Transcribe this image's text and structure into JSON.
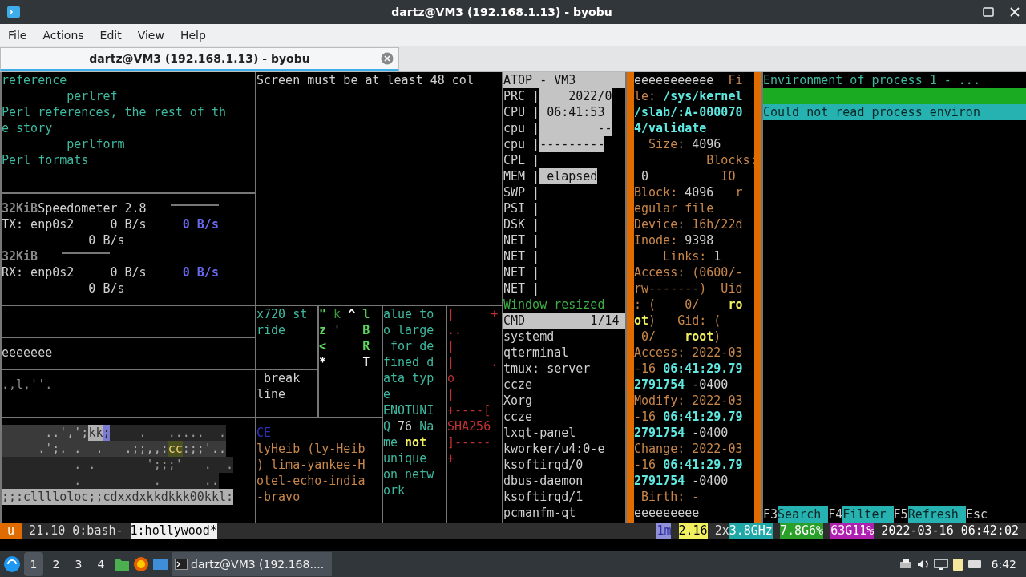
{
  "window": {
    "title": "dartz@VM3 (192.168.1.13) - byobu"
  },
  "menu": [
    "File",
    "Actions",
    "Edit",
    "View",
    "Help"
  ],
  "tabs": [
    {
      "label": "dartz@VM3 (192.168.1.13) - byobu",
      "selected": true
    }
  ],
  "panes": [
    {
      "lines": [
        {
          "segs": [
            {
              "text": "reference",
              "kind": "teal"
            }
          ]
        },
        {
          "segs": [
            {
              "text": "         perlref",
              "kind": "teal"
            }
          ]
        },
        {
          "segs": [
            {
              "text": "Perl references, the rest of th",
              "kind": "teal"
            }
          ]
        },
        {
          "segs": [
            {
              "text": "e story",
              "kind": "teal"
            }
          ]
        },
        {
          "segs": [
            {
              "text": "         perlform",
              "kind": "teal"
            }
          ]
        },
        {
          "segs": [
            {
              "text": "Perl formats",
              "kind": "teal"
            }
          ]
        }
      ]
    },
    {
      "lines": [
        {
          "segs": [
            {
              "text": "Screen must be at least 48 col",
              "kind": "plain"
            }
          ]
        }
      ]
    },
    {
      "lines": [
        {
          "kind": "header",
          "segs": [
            {
              "text": "ATOP - VM3",
              "kind": "inverse"
            }
          ]
        },
        {
          "segs": [
            {
              "text": "PRC |",
              "kind": "plain"
            },
            {
              "text": "    2022/0",
              "kind": "inverse"
            }
          ]
        },
        {
          "segs": [
            {
              "text": "CPU |",
              "kind": "plain"
            },
            {
              "text": " 06:41:53 ",
              "kind": "inverse"
            }
          ]
        },
        {
          "segs": [
            {
              "text": "cpu |",
              "kind": "plain"
            },
            {
              "text": "        --",
              "kind": "inverse"
            }
          ]
        },
        {
          "segs": [
            {
              "text": "cpu |",
              "kind": "plain"
            },
            {
              "text": "---------",
              "kind": "inverse"
            }
          ]
        },
        {
          "segs": [
            {
              "text": "CPL |",
              "kind": "plain"
            }
          ]
        },
        {
          "segs": [
            {
              "text": "MEM |",
              "kind": "plain"
            },
            {
              "text": " elapsed",
              "kind": "inverse"
            }
          ]
        },
        {
          "segs": [
            {
              "text": "SWP |",
              "kind": "plain"
            }
          ]
        },
        {
          "segs": [
            {
              "text": "PSI |",
              "kind": "plain"
            }
          ]
        },
        {
          "segs": [
            {
              "text": "DSK |",
              "kind": "plain"
            }
          ]
        },
        {
          "segs": [
            {
              "text": "NET |",
              "kind": "plain"
            }
          ]
        },
        {
          "segs": [
            {
              "text": "NET |",
              "kind": "plain"
            }
          ]
        },
        {
          "segs": [
            {
              "text": "NET |",
              "kind": "plain"
            }
          ]
        },
        {
          "segs": [
            {
              "text": "NET |",
              "kind": "plain"
            }
          ]
        },
        {
          "segs": [
            {
              "text": "Window resized",
              "kind": "green"
            }
          ]
        },
        {
          "kind": "header",
          "segs": [
            {
              "text": "CMD         1/14",
              "kind": "inverse"
            }
          ]
        },
        {
          "segs": [
            {
              "text": "systemd",
              "kind": "plain"
            }
          ]
        },
        {
          "segs": [
            {
              "text": "qterminal",
              "kind": "plain"
            }
          ]
        },
        {
          "segs": [
            {
              "text": "tmux: server",
              "kind": "plain"
            }
          ]
        },
        {
          "segs": [
            {
              "text": "ccze",
              "kind": "plain"
            }
          ]
        },
        {
          "segs": [
            {
              "text": "Xorg",
              "kind": "plain"
            }
          ]
        },
        {
          "segs": [
            {
              "text": "ccze",
              "kind": "plain"
            }
          ]
        },
        {
          "segs": [
            {
              "text": "lxqt-panel",
              "kind": "plain"
            }
          ]
        },
        {
          "segs": [
            {
              "text": "kworker/u4:0-e",
              "kind": "plain"
            }
          ]
        },
        {
          "segs": [
            {
              "text": "ksoftirqd/0",
              "kind": "plain"
            }
          ]
        },
        {
          "segs": [
            {
              "text": "dbus-daemon",
              "kind": "plain"
            }
          ]
        },
        {
          "segs": [
            {
              "text": "ksoftirqd/1",
              "kind": "plain"
            }
          ]
        },
        {
          "segs": [
            {
              "text": "pcmanfm-qt",
              "kind": "plain"
            }
          ]
        }
      ]
    },
    {
      "lines": [
        {
          "segs": [
            {
              "text": "eeeeeeeeeee  ",
              "kind": "plain"
            },
            {
              "text": "Fi",
              "kind": "orange"
            }
          ]
        },
        {
          "segs": [
            {
              "text": "le: ",
              "kind": "orange"
            },
            {
              "text": "/sys/kernel",
              "kind": "path"
            }
          ]
        },
        {
          "segs": [
            {
              "text": "/slab/:A-000070",
              "kind": "path"
            }
          ]
        },
        {
          "segs": [
            {
              "text": "4/validate",
              "kind": "path"
            }
          ]
        },
        {
          "segs": [
            {
              "text": "  Size: ",
              "kind": "orange"
            },
            {
              "text": "4096",
              "kind": "plain"
            }
          ]
        },
        {
          "segs": [
            {
              "text": "          Blocks:",
              "kind": "orange"
            }
          ]
        },
        {
          "segs": [
            {
              "text": " 0",
              "kind": "plain"
            },
            {
              "text": "          IO",
              "kind": "orange"
            }
          ]
        },
        {
          "segs": [
            {
              "text": "Block: ",
              "kind": "orange"
            },
            {
              "text": "4096",
              "kind": "plain"
            },
            {
              "text": "   r",
              "kind": "orange"
            }
          ]
        },
        {
          "segs": [
            {
              "text": "egular file",
              "kind": "orange"
            }
          ]
        },
        {
          "segs": [
            {
              "text": "Device: 16h/22d",
              "kind": "orange"
            }
          ]
        },
        {
          "segs": [
            {
              "text": "Inode: ",
              "kind": "orange"
            },
            {
              "text": "9398",
              "kind": "plain"
            }
          ]
        },
        {
          "segs": [
            {
              "text": "    Links: ",
              "kind": "orange"
            },
            {
              "text": "1",
              "kind": "plain"
            }
          ]
        },
        {
          "segs": [
            {
              "text": "Access: (0600/-",
              "kind": "orange"
            }
          ]
        },
        {
          "segs": [
            {
              "text": "rw-------)  Uid",
              "kind": "orange"
            }
          ]
        },
        {
          "segs": [
            {
              "text": ": (    0/    ",
              "kind": "orange"
            },
            {
              "text": "ro",
              "kind": "user"
            }
          ]
        },
        {
          "segs": [
            {
              "text": "ot",
              "kind": "user"
            },
            {
              "text": ")   Gid: (",
              "kind": "orange"
            }
          ]
        },
        {
          "segs": [
            {
              "text": " 0/    ",
              "kind": "orange"
            },
            {
              "text": "root",
              "kind": "user"
            },
            {
              "text": ")",
              "kind": "orange"
            }
          ]
        },
        {
          "segs": [
            {
              "text": "Access: 2022-03",
              "kind": "orange"
            }
          ]
        },
        {
          "segs": [
            {
              "text": "-16 ",
              "kind": "orange"
            },
            {
              "text": "06:41:29.79",
              "kind": "path"
            }
          ]
        },
        {
          "segs": [
            {
              "text": "2791754",
              "kind": "path"
            },
            {
              "text": " -0400",
              "kind": "plain"
            }
          ]
        },
        {
          "segs": [
            {
              "text": "Modify: 2022-03",
              "kind": "orange"
            }
          ]
        },
        {
          "segs": [
            {
              "text": "-16 ",
              "kind": "orange"
            },
            {
              "text": "06:41:29.79",
              "kind": "path"
            }
          ]
        },
        {
          "segs": [
            {
              "text": "2791754",
              "kind": "path"
            },
            {
              "text": " -0400",
              "kind": "plain"
            }
          ]
        },
        {
          "segs": [
            {
              "text": "Change: 2022-03",
              "kind": "orange"
            }
          ]
        },
        {
          "segs": [
            {
              "text": "-16 ",
              "kind": "orange"
            },
            {
              "text": "06:41:29.79",
              "kind": "path"
            }
          ]
        },
        {
          "segs": [
            {
              "text": "2791754",
              "kind": "path"
            },
            {
              "text": " -0400",
              "kind": "plain"
            }
          ]
        },
        {
          "segs": [
            {
              "text": " Birth: -",
              "kind": "orange"
            }
          ]
        },
        {
          "segs": [
            {
              "text": "eeeeeeeee",
              "kind": "plain"
            }
          ]
        }
      ]
    },
    {
      "lines": [
        {
          "segs": [
            {
              "text": "Environment of process 1 - ...",
              "kind": "teal"
            }
          ]
        },
        {
          "kind": "success"
        },
        {
          "kind": "message",
          "segs": [
            {
              "text": "Could not read process environ",
              "kind": "dark"
            }
          ]
        }
      ],
      "footer": [
        {
          "key": "F3",
          "label": "Search"
        },
        {
          "key": "F4",
          "label": "Filter"
        },
        {
          "key": "F5",
          "label": "Refresh"
        },
        {
          "key": "Esc"
        }
      ]
    },
    {
      "lines": [
        {
          "rule": true,
          "segs": [
            {
              "text": "32KiB",
              "kind": "dim"
            },
            {
              "text": "Speedometer 2.8",
              "kind": "plain"
            }
          ]
        },
        {
          "segs": [
            {
              "text": "TX: enp0s2     0 B/s     ",
              "kind": "plain"
            },
            {
              "text": "0 B/s",
              "kind": "rate"
            }
          ]
        },
        {
          "segs": [
            {
              "text": "            0 B/s",
              "kind": "plain"
            }
          ]
        },
        {
          "rule": true,
          "segs": [
            {
              "text": "32KiB",
              "kind": "dim"
            }
          ]
        },
        {
          "segs": [
            {
              "text": "RX: enp0s2     0 B/s     ",
              "kind": "plain"
            },
            {
              "text": "0 B/s",
              "kind": "rate"
            }
          ]
        },
        {
          "segs": [
            {
              "text": "            0 B/s",
              "kind": "plain"
            }
          ]
        }
      ]
    },
    {
      "lines": [
        {
          "segs": [
            {
              "text": "x720 st",
              "kind": "teal"
            }
          ]
        },
        {
          "segs": [
            {
              "text": "ride",
              "kind": "teal"
            }
          ]
        }
      ]
    },
    {
      "lines": [
        {
          "segs": [
            {
              "text": "\" ",
              "kind": "key"
            },
            {
              "text": "k ",
              "kind": "keydim"
            },
            {
              "text": "^ ",
              "kind": "bright"
            },
            {
              "text": "l",
              "kind": "key"
            }
          ]
        },
        {
          "segs": [
            {
              "text": "z ",
              "kind": "key"
            },
            {
              "text": "'   ",
              "kind": "plain"
            },
            {
              "text": "B",
              "kind": "key"
            }
          ]
        },
        {
          "segs": [
            {
              "text": "<     R",
              "kind": "key"
            }
          ]
        },
        {
          "segs": [
            {
              "text": "*     T",
              "kind": "bright"
            }
          ]
        }
      ]
    },
    {
      "lines": [
        {
          "segs": [
            {
              "text": "alue to",
              "kind": "teal"
            }
          ]
        },
        {
          "segs": [
            {
              "text": "o large",
              "kind": "teal"
            }
          ]
        },
        {
          "segs": [
            {
              "text": " for de",
              "kind": "teal"
            }
          ]
        },
        {
          "segs": [
            {
              "text": "fined d",
              "kind": "teal"
            }
          ]
        },
        {
          "segs": [
            {
              "text": "ata typ",
              "kind": "teal"
            }
          ]
        },
        {
          "segs": [
            {
              "text": "e",
              "kind": "teal"
            }
          ]
        },
        {
          "segs": [
            {
              "text": "ENOTUNI",
              "kind": "teal"
            }
          ]
        },
        {
          "segs": [
            {
              "text": "Q ",
              "kind": "teal"
            },
            {
              "text": "76",
              "kind": "plain"
            },
            {
              "text": " Na",
              "kind": "teal"
            }
          ]
        },
        {
          "segs": [
            {
              "text": "me ",
              "kind": "teal"
            },
            {
              "text": "not",
              "kind": "user"
            }
          ]
        },
        {
          "segs": [
            {
              "text": "unique",
              "kind": "teal"
            }
          ]
        },
        {
          "segs": [
            {
              "text": "on netw",
              "kind": "teal"
            }
          ]
        },
        {
          "segs": [
            {
              "text": "ork",
              "kind": "teal"
            }
          ]
        }
      ]
    },
    {
      "lines": [
        {
          "segs": [
            {
              "text": "|     +",
              "kind": "red"
            }
          ]
        },
        {
          "segs": [
            {
              "text": "..",
              "kind": "red"
            }
          ]
        },
        {
          "segs": [
            {
              "text": "|",
              "kind": "red"
            }
          ]
        },
        {
          "segs": [
            {
              "text": "|     .",
              "kind": "red"
            }
          ]
        },
        {
          "segs": [
            {
              "text": "o",
              "kind": "red"
            }
          ]
        },
        {
          "segs": [
            {
              "text": "|",
              "kind": "red"
            }
          ]
        },
        {
          "segs": [
            {
              "text": "+----[",
              "kind": "red"
            }
          ]
        },
        {
          "segs": [
            {
              "text": "SHA256",
              "kind": "red"
            }
          ]
        },
        {
          "segs": [
            {
              "text": "]-----",
              "kind": "red"
            }
          ]
        },
        {
          "segs": [
            {
              "text": "+",
              "kind": "red"
            }
          ]
        }
      ]
    },
    {
      "lines": [
        {
          "segs": [
            {
              "text": "eeeeeee",
              "kind": "plain"
            }
          ]
        }
      ]
    },
    {
      "lines": [
        {
          "segs": [
            {
              "text": ".,l,''.",
              "kind": "faint"
            }
          ]
        }
      ]
    },
    {
      "lines": [
        {
          "segs": [
            {
              "text": " break",
              "kind": "plain"
            }
          ]
        },
        {
          "segs": [
            {
              "text": "line",
              "kind": "plain"
            }
          ]
        }
      ]
    },
    {
      "lines": [
        {
          "segs": [
            {
              "text": "      ..',';",
              "kind": "shaded"
            },
            {
              "text": "kk",
              "kind": "light"
            },
            {
              "text": ";",
              "kind": "bluish"
            },
            {
              "text": "    .   .....  .",
              "kind": "smoky"
            }
          ]
        },
        {
          "segs": [
            {
              "text": "     .';. .  .   .;;,,:",
              "kind": "shaded"
            },
            {
              "text": "cc",
              "kind": "olive"
            },
            {
              "text": ":;;'..",
              "kind": "shaded"
            }
          ]
        },
        {
          "segs": [
            {
              "text": "          . .       ';;;'   .  .",
              "kind": "smoky"
            }
          ]
        },
        {
          "segs": [
            {
              "text": "          .          .      ..",
              "kind": "smoky"
            }
          ]
        },
        {
          "segs": [
            {
              "text": ";;:clllloloc;;cdxxdxkkdkkk00kkl:",
              "kind": "light"
            }
          ]
        }
      ]
    },
    {
      "lines": [
        {
          "segs": [
            {
              "text": "CE",
              "kind": "blue"
            }
          ]
        },
        {
          "segs": [
            {
              "text": "lyHeib (ly-Heib",
              "kind": "orange"
            }
          ]
        },
        {
          "segs": [
            {
              "text": ") lima-yankee-H",
              "kind": "orange"
            }
          ]
        },
        {
          "segs": [
            {
              "text": "otel-echo-india",
              "kind": "orange"
            }
          ]
        },
        {
          "segs": [
            {
              "text": "-bravo",
              "kind": "orange"
            }
          ]
        }
      ]
    }
  ],
  "status_bar": {
    "session": "u",
    "version": "21.10",
    "windows": [
      {
        "label": "0:bash-",
        "selected": false
      },
      {
        "label": "1:hollywood*",
        "selected": true
      }
    ],
    "load_period": "1m",
    "load": "2.16",
    "cpu_count": "2x",
    "cpu_freq": "3.8GHz",
    "memory": "7.8G6%",
    "disk": "63G11%",
    "datetime": "2022-03-16 06:42:02"
  },
  "taskbar": {
    "desktops": [
      {
        "label": "1",
        "selected": true
      },
      {
        "label": "2",
        "selected": false
      },
      {
        "label": "3",
        "selected": false
      },
      {
        "label": "4",
        "selected": false
      }
    ],
    "task": "dartz@VM3 (192.168....",
    "clock": "6:42"
  }
}
